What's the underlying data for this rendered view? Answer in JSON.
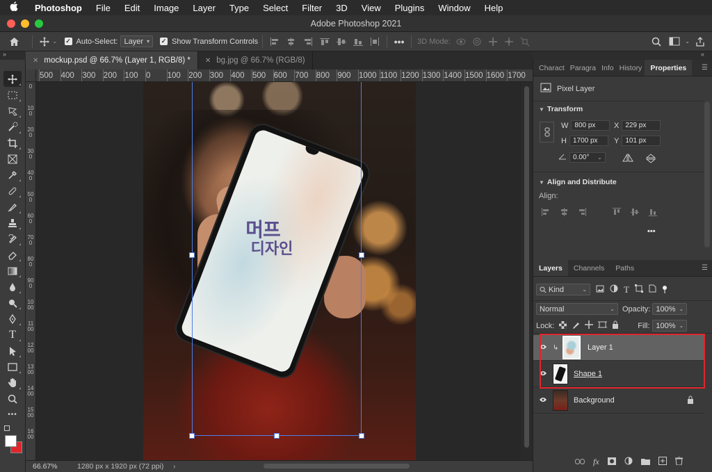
{
  "menubar": {
    "app": "Photoshop",
    "items": [
      "File",
      "Edit",
      "Image",
      "Layer",
      "Type",
      "Select",
      "Filter",
      "3D",
      "View",
      "Plugins",
      "Window",
      "Help"
    ]
  },
  "window": {
    "title": "Adobe Photoshop 2021"
  },
  "options": {
    "auto_select_label": "Auto-Select:",
    "auto_select_value": "Layer",
    "show_transform_label": "Show Transform Controls",
    "mode_3d_label": "3D Mode:"
  },
  "tabs": [
    {
      "label": "mockup.psd @ 66.7% (Layer 1, RGB/8) *"
    },
    {
      "label": "bg.jpg @ 66.7% (RGB/8)"
    }
  ],
  "ruler": {
    "h_ticks": [
      "500",
      "400",
      "300",
      "200",
      "100",
      "0",
      "100",
      "200",
      "300",
      "400",
      "500",
      "600",
      "700",
      "800",
      "900",
      "1000",
      "1100",
      "1200",
      "1300",
      "1400",
      "1500",
      "1600",
      "1700"
    ],
    "v_ticks": [
      "0",
      "100",
      "200",
      "300",
      "400",
      "500",
      "600",
      "700",
      "800",
      "900",
      "1000",
      "1100",
      "1200",
      "1300",
      "1400",
      "1500",
      "1600"
    ]
  },
  "mockup": {
    "title_line1": "머프",
    "title_line2": "디자인"
  },
  "status": {
    "zoom": "66.67%",
    "doc_info": "1280 px x 1920 px (72 ppi)"
  },
  "properties": {
    "tabs": [
      "Charact",
      "Paragra",
      "Info",
      "History",
      "Properties"
    ],
    "layer_type": "Pixel Layer",
    "transform_title": "Transform",
    "w_label": "W",
    "w_value": "800 px",
    "x_label": "X",
    "x_value": "229 px",
    "h_label": "H",
    "h_value": "1700 px",
    "y_label": "Y",
    "y_value": "101 px",
    "angle_value": "0.00°",
    "align_title": "Align and Distribute",
    "align_label": "Align:"
  },
  "layers_panel": {
    "tabs": [
      "Layers",
      "Channels",
      "Paths"
    ],
    "kind_label": "Kind",
    "blend_mode": "Normal",
    "opacity_label": "Opacity:",
    "opacity_value": "100%",
    "lock_label": "Lock:",
    "fill_label": "Fill:",
    "fill_value": "100%",
    "layers": [
      {
        "name": "Layer 1",
        "selected": true
      },
      {
        "name": "Shape 1",
        "selected": false
      },
      {
        "name": "Background",
        "selected": false
      }
    ],
    "highlight_color": "#e0262d"
  }
}
